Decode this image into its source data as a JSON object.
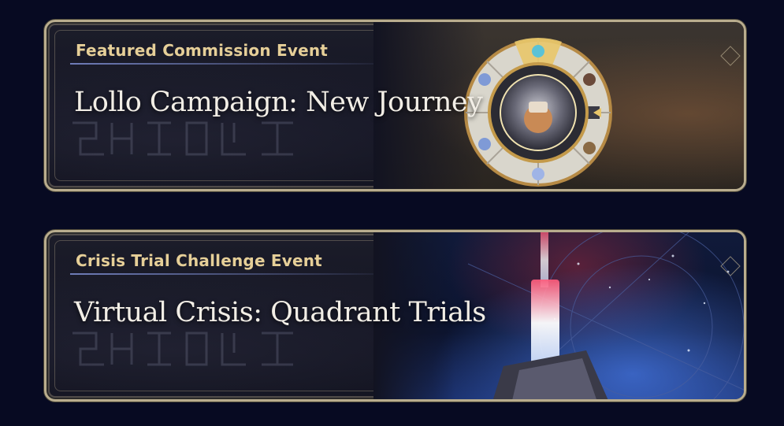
{
  "events": [
    {
      "category": "Featured Commission Event",
      "title": "Lollo Campaign: New Journey"
    },
    {
      "category": "Crisis Trial Challenge Event",
      "title": "Virtual Crisis: Quadrant Trials"
    }
  ],
  "icons": {
    "event1_art": "commission-wheel-icon",
    "event2_art": "crisis-tower-icon"
  },
  "colors": {
    "background": "#070a22",
    "frame": "#b9ad8e",
    "category_text": "#e6cf98",
    "title_text": "#f2eee6",
    "underline": "#7887c8"
  }
}
